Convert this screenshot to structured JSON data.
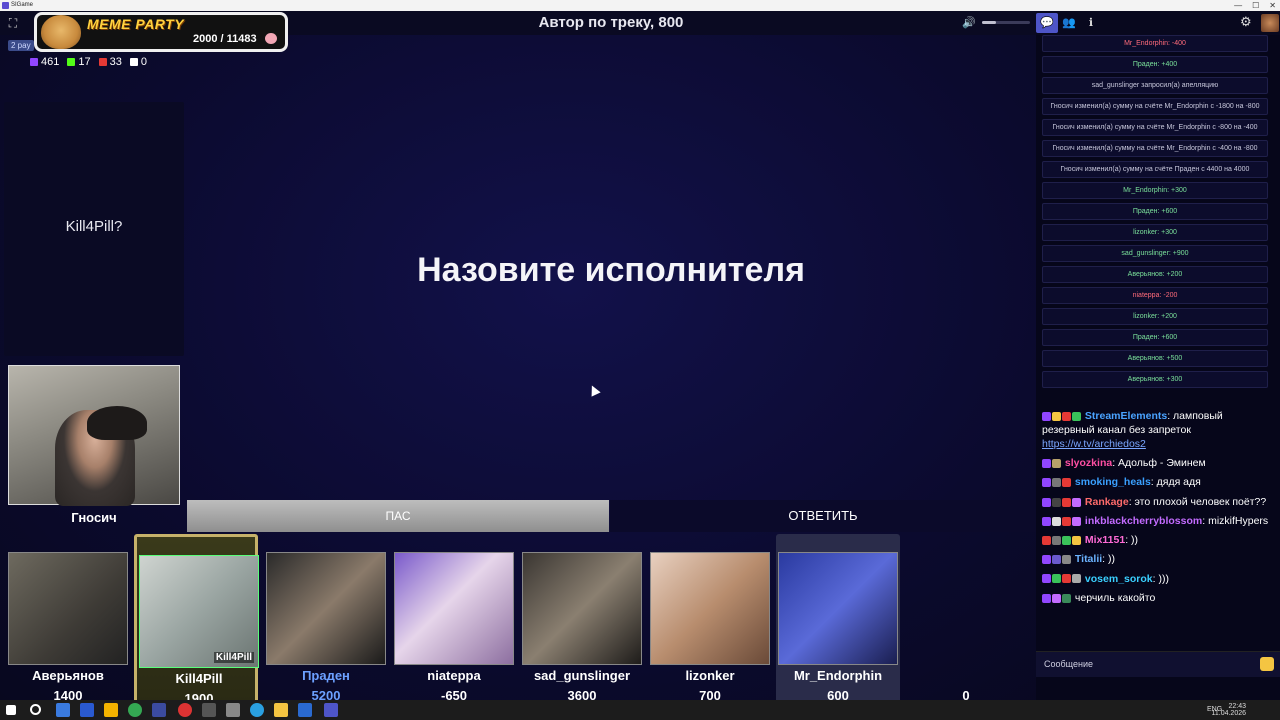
{
  "window": {
    "app_name": "SIGame"
  },
  "header": {
    "round_title": "Автор по треку, 800"
  },
  "overlay": {
    "badge_title": "MEME PARTY",
    "progress": "2000 / 11483",
    "tag": "2 pay"
  },
  "stats": {
    "viewers": "461",
    "likes": "17",
    "subs": "33",
    "other": "0"
  },
  "host": {
    "answer_text": "Kill4Pill?",
    "name": "Гносич"
  },
  "question": {
    "text": "Назовите исполнителя"
  },
  "actions": {
    "pass_label": "ПАС",
    "answer_label": "ОТВЕТИТЬ"
  },
  "players": [
    {
      "name": "Аверьянов",
      "score": "1400"
    },
    {
      "name": "Kill4Pill",
      "score": "1900",
      "cam_tag": "Kill4Pill"
    },
    {
      "name": "Праден",
      "score": "5200"
    },
    {
      "name": "niateppa",
      "score": "-650"
    },
    {
      "name": "sad_gunslinger",
      "score": "3600"
    },
    {
      "name": "lizonker",
      "score": "700"
    },
    {
      "name": "Mr_Endorphin",
      "score": "600"
    },
    {
      "name": "",
      "score": "0"
    }
  ],
  "log": [
    "Mr_Endorphin: -400",
    "Праден: +400",
    "sad_gunslinger запросил(а) апелляцию",
    "Гносич изменил(а) сумму на счёте Mr_Endorphin с -1800 на -800",
    "Гносич изменил(а) сумму на счёте Mr_Endorphin с -800 на -400",
    "Гносич изменил(а) сумму на счёте Mr_Endorphin с -400 на -800",
    "Гносич изменил(а) сумму на счёте Праден с 4400 на 4000",
    "Mr_Endorphin: +300",
    "Праден: +600",
    "lizonker: +300",
    "sad_gunslinger: +900",
    "Аверьянов: +200",
    "niateppa: -200",
    "lizonker: +200",
    "Праден: +600",
    "Аверьянов: +500",
    "Аверьянов: +300"
  ],
  "chat": [
    {
      "user": "StreamElements",
      "text": ": ламповый резервный канал без запреток",
      "link": "https://w.tv/archiedos2",
      "color": "#4aa3ff"
    },
    {
      "user": "slyozkina",
      "text": ": Адольф - Эминем",
      "link": "",
      "color": "#ff4fa3"
    },
    {
      "user": "smoking_heals",
      "text": ": дядя адя",
      "link": "",
      "color": "#3aa0ff"
    },
    {
      "user": "Rankage",
      "text": ": это плохой человек поёт??",
      "link": "",
      "color": "#ff6b6b"
    },
    {
      "user": "inkblackcherryblossom",
      "text": ": mizkifHypers",
      "link": "",
      "color": "#c36bff"
    },
    {
      "user": "Mix1151",
      "text": ": ))",
      "link": "",
      "color": "#ff6bd6"
    },
    {
      "user": "Titalii",
      "text": ": ))",
      "link": "",
      "color": "#6bb3ff"
    },
    {
      "user": "vosem_sorok",
      "text": ": )))",
      "link": "",
      "color": "#3ad0ff"
    },
    {
      "user": "",
      "text": "черчиль какойто",
      "link": "",
      "color": "#ffffff"
    }
  ],
  "input": {
    "placeholder": "Сообщение"
  },
  "taskbar": {
    "time": "22:43",
    "date": "11.04.2026",
    "lang": "ENG"
  }
}
